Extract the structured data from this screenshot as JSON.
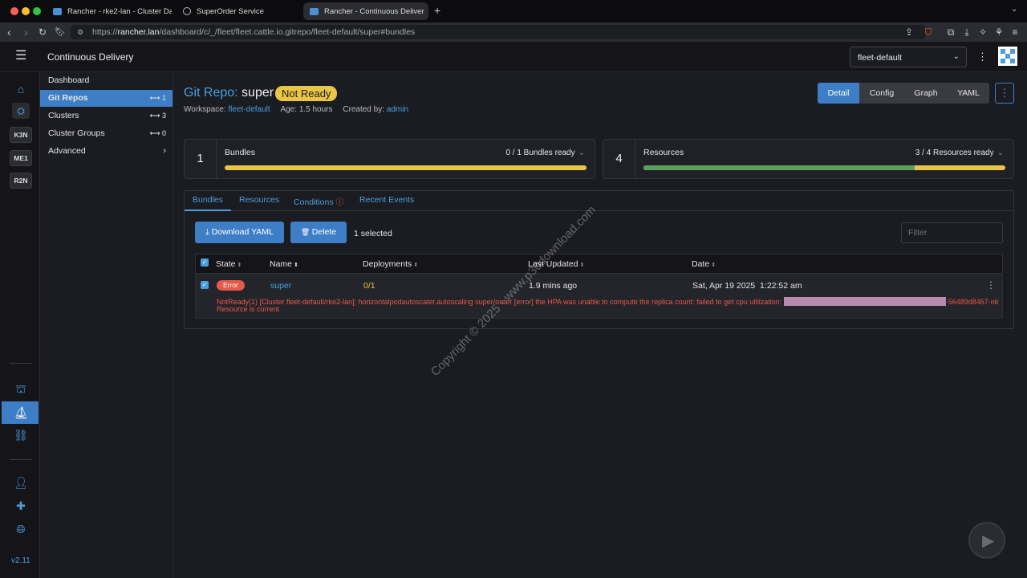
{
  "browser": {
    "tabs": [
      {
        "title": "Rancher - rke2-lan - Cluster Das"
      },
      {
        "title": "SuperOrder Service"
      },
      {
        "title": "Rancher - Continuous Deliver"
      }
    ],
    "url_prefix": "https://",
    "url_host": "rancher.lan",
    "url_path": "/dashboard/c/_/fleet/fleet.cattle.io.gitrepo/fleet-default/super#bundles"
  },
  "header": {
    "title": "Continuous Delivery",
    "workspace_select": "fleet-default"
  },
  "rail": {
    "chips": [
      "K3N",
      "ME1",
      "R2N"
    ],
    "version": "v2.11"
  },
  "sidenav": {
    "items": [
      {
        "label": "Dashboard",
        "count": ""
      },
      {
        "label": "Git Repos",
        "count": "1"
      },
      {
        "label": "Clusters",
        "count": "3"
      },
      {
        "label": "Cluster Groups",
        "count": "0"
      },
      {
        "label": "Advanced",
        "count": ""
      }
    ]
  },
  "page": {
    "type_label": "Git Repo:",
    "name": "super",
    "status": "Not Ready",
    "workspace_label": "Workspace:",
    "workspace": "fleet-default",
    "age_label": "Age:",
    "age": "1.5 hours",
    "created_label": "Created by:",
    "created_by": "admin",
    "views": [
      "Detail",
      "Config",
      "Graph",
      "YAML"
    ]
  },
  "cards": {
    "bundles": {
      "count": "1",
      "label": "Bundles",
      "summary": "0 / 1 Bundles ready",
      "ready_fraction": 0.0
    },
    "resources": {
      "count": "4",
      "label": "Resources",
      "summary": "3 / 4 Resources ready",
      "ready_fraction": 0.75
    }
  },
  "tabs": [
    "Bundles",
    "Resources",
    "Conditions",
    "Recent Events"
  ],
  "toolbar": {
    "download": "Download YAML",
    "delete": "Delete",
    "selected": "1 selected",
    "filter_placeholder": "Filter"
  },
  "table": {
    "columns": [
      "State",
      "Name",
      "Deployments",
      "Last Updated",
      "Date"
    ],
    "rows": [
      {
        "state": "Error",
        "name": "super",
        "deployments": "0/1",
        "last_updated": "1.9 mins ago",
        "date": "Sat, Apr 19 2025  1:22:52 am",
        "message_1": "NotReady(1) [Cluster fleet-default/rke2-lan]; horizontalpodautoscaler.autoscaling super/order [error] the HPA was unable to compute the replica count: failed to get cpu utilization:",
        "message_highlight": "unable to get metrics for resource cpu: no metrics returned from resource metrics API for pod super-order",
        "message_tail": "-56489d8467-nk9dp,",
        "message_2": "Resource is current"
      }
    ]
  },
  "watermark": "Copyright © 2025 - www.p30download.com",
  "colors": {
    "accent": "#3d7ec7",
    "warning": "#e8c547",
    "error": "#e5594a",
    "success": "#5aa05a"
  }
}
